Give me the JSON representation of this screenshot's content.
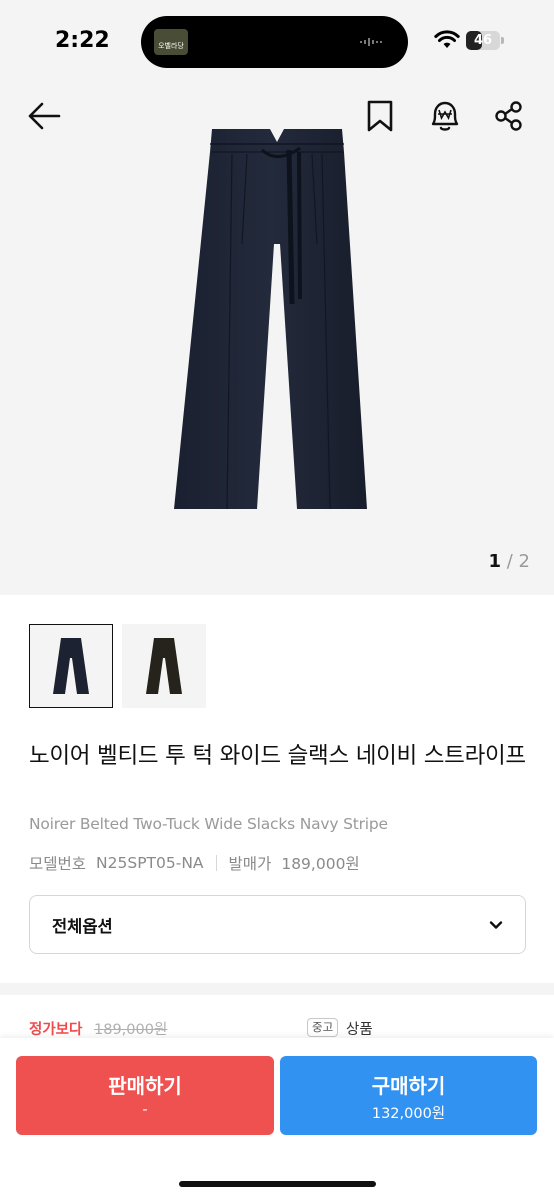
{
  "status_bar": {
    "time": "2:22",
    "battery_percent": 46,
    "battery_label": "46",
    "island_thumb_label": "오벨라당"
  },
  "gallery": {
    "current_page": "1",
    "separator": "/",
    "total_pages": "2",
    "icons": [
      "back-arrow-icon",
      "bookmark-icon",
      "price-alert-icon",
      "share-icon"
    ]
  },
  "product": {
    "title_ko": "노이어 벨티드 투 턱 와이드 슬랙스 네이비 스트라이프",
    "title_en": "Noirer Belted Two-Tuck Wide Slacks Navy Stripe",
    "model_label": "모델번호",
    "model_value": "N25SPT05-NA",
    "release_label": "발매가",
    "release_value": "189,000원"
  },
  "options": {
    "label": "전체옵션"
  },
  "peek": {
    "compare_label": "정가보다",
    "original_price": "189,000원",
    "condition_badge": "중고",
    "condition_text": "상품"
  },
  "actions": {
    "sell_label": "판매하기",
    "sell_sub": "-",
    "buy_label": "구매하기",
    "buy_sub": "132,000원"
  },
  "colors": {
    "sell": "#ef5050",
    "buy": "#3192f2",
    "accent_red": "#ef4b4b"
  }
}
